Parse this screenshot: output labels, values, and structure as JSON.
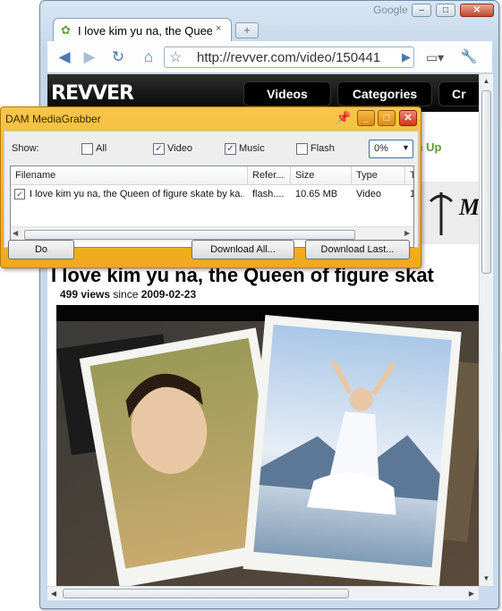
{
  "browser": {
    "brand": "Google",
    "tab": {
      "title": "I love kim yu na, the Queen of figure skate by kazu",
      "close": "×"
    },
    "new_tab": "+",
    "controls": {
      "minimize": "–",
      "maximize": "□",
      "close": "✕"
    },
    "toolbar": {
      "back_icon": "back-arrow",
      "forward_icon": "forward-arrow",
      "reload_icon": "reload",
      "home_icon": "home",
      "star_icon": "bookmark-star",
      "url": "http://revver.com/video/150441",
      "page_menu_icon": "page-menu",
      "tools_menu_icon": "wrench"
    }
  },
  "site": {
    "logo": "REVVER",
    "nav": [
      "Videos",
      "Categories",
      "Cr"
    ],
    "sign_up": "ign Up",
    "ad_text": "M",
    "video": {
      "title": "I love kim yu na, the Queen of figure skat",
      "views": "499 views",
      "since_label": "since",
      "date": "2009-02-23"
    }
  },
  "mediagrabber": {
    "title": "DAM MediaGrabber",
    "show_label": "Show:",
    "filters": [
      {
        "label": "All",
        "checked": false
      },
      {
        "label": "Video",
        "checked": true
      },
      {
        "label": "Music",
        "checked": true
      },
      {
        "label": "Flash",
        "checked": false
      }
    ],
    "percent": "0%",
    "columns": [
      "Filename",
      "Refer...",
      "Size",
      "Type",
      "T"
    ],
    "rows": [
      {
        "checked": true,
        "filename": "I love kim yu na, the Queen of figure skate by ka...",
        "referer": "flash....",
        "size": "10.65 MB",
        "type": "Video",
        "extra": "1"
      }
    ],
    "buttons": {
      "do": "Do",
      "download_all": "Download All...",
      "download_last": "Download Last..."
    }
  },
  "colors": {
    "dialog_orange": "#f0a91c",
    "site_header": "#050505",
    "sign_up_green": "#5a9a3a"
  }
}
